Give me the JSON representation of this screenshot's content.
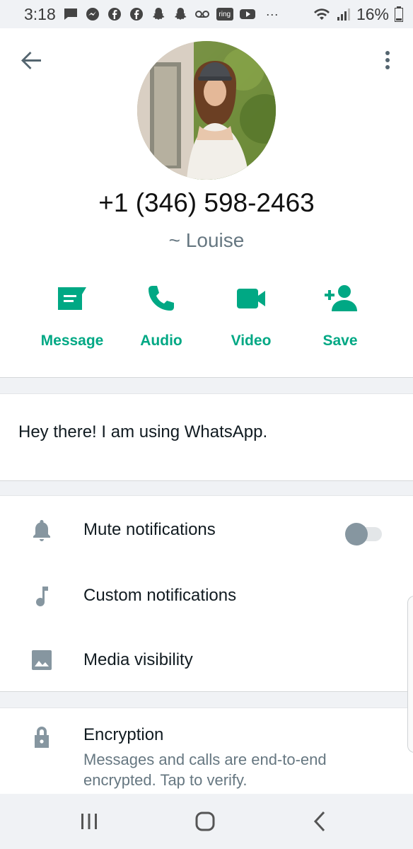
{
  "status_bar": {
    "time": "3:18",
    "notification_icons": [
      "message-icon",
      "messenger-icon",
      "facebook-icon",
      "facebook-icon",
      "snapchat-icon",
      "snapchat-icon",
      "voicemail-icon",
      "ring-icon",
      "youtube-icon"
    ],
    "ring_label": "ring",
    "more": "···",
    "battery": "16%"
  },
  "contact": {
    "phone": "+1 (346) 598-2463",
    "pushname": "~ Louise"
  },
  "actions": [
    {
      "label": "Message",
      "icon": "message-icon"
    },
    {
      "label": "Audio",
      "icon": "phone-icon"
    },
    {
      "label": "Video",
      "icon": "video-icon"
    },
    {
      "label": "Save",
      "icon": "add-contact-icon"
    }
  ],
  "about": "Hey there! I am using WhatsApp.",
  "settings": {
    "mute": {
      "label": "Mute notifications",
      "enabled": false
    },
    "custom": {
      "label": "Custom notifications"
    },
    "media": {
      "label": "Media visibility"
    }
  },
  "encryption": {
    "title": "Encryption",
    "description": "Messages and calls are end-to-end encrypted. Tap to verify."
  },
  "colors": {
    "accent": "#00a884",
    "icon_gray": "#8696a0",
    "secondary_text": "#667781"
  }
}
